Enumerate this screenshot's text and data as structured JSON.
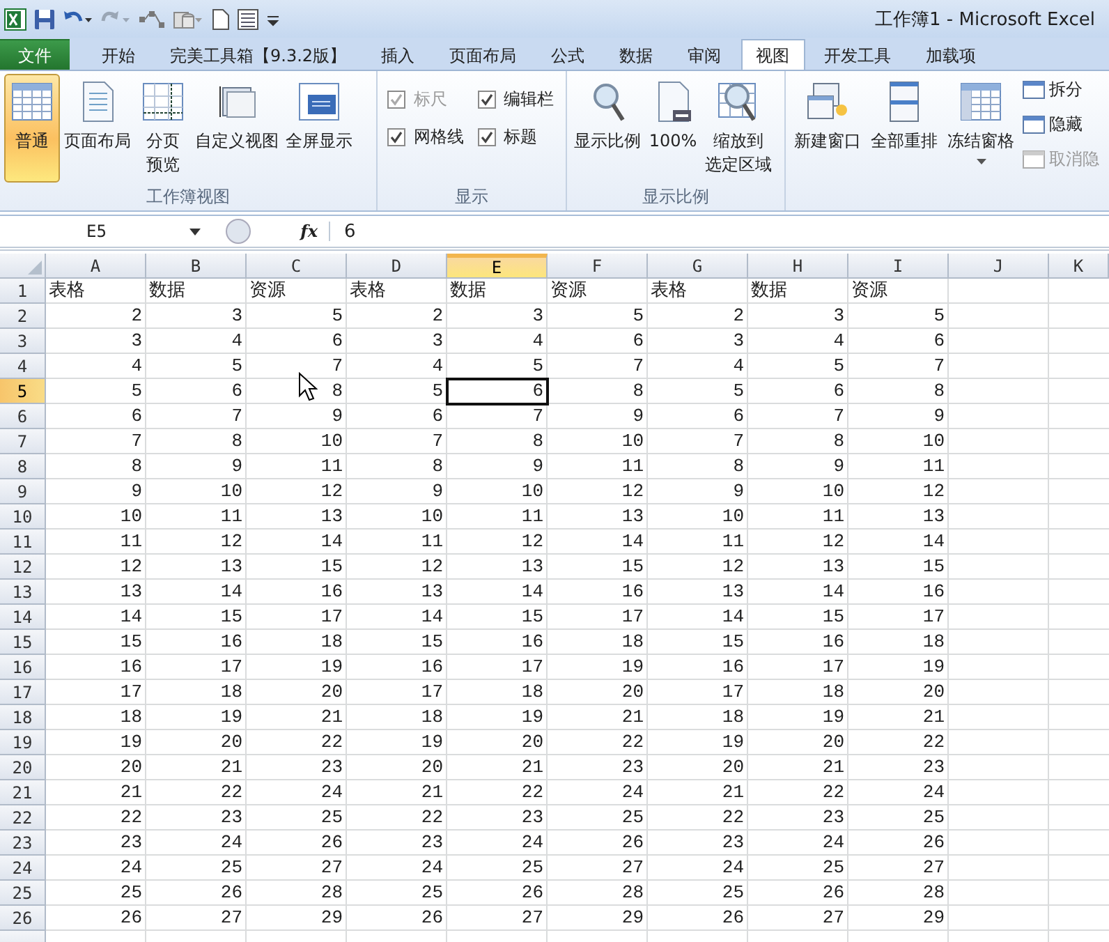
{
  "window": {
    "title": "工作簿1 - Microsoft Excel"
  },
  "tabs": [
    {
      "label": "文件",
      "kind": "file",
      "selected": false
    },
    {
      "label": "开始",
      "kind": "tab",
      "selected": false
    },
    {
      "label": "完美工具箱【9.3.2版】",
      "kind": "tab",
      "selected": false
    },
    {
      "label": "插入",
      "kind": "tab",
      "selected": false
    },
    {
      "label": "页面布局",
      "kind": "tab",
      "selected": false
    },
    {
      "label": "公式",
      "kind": "tab",
      "selected": false
    },
    {
      "label": "数据",
      "kind": "tab",
      "selected": false
    },
    {
      "label": "审阅",
      "kind": "tab",
      "selected": false
    },
    {
      "label": "视图",
      "kind": "tab",
      "selected": true
    },
    {
      "label": "开发工具",
      "kind": "tab",
      "selected": false
    },
    {
      "label": "加载项",
      "kind": "tab",
      "selected": false
    }
  ],
  "ribbon": {
    "groups": [
      {
        "label": "工作簿视图",
        "items": [
          {
            "kind": "big",
            "lines": [
              "普通"
            ],
            "selected": true
          },
          {
            "kind": "big",
            "lines": [
              "页面布局"
            ],
            "selected": false
          },
          {
            "kind": "big",
            "lines": [
              "分页",
              "预览"
            ],
            "selected": false
          },
          {
            "kind": "big",
            "lines": [
              "自定义视图"
            ],
            "selected": false
          },
          {
            "kind": "big",
            "lines": [
              "全屏显示"
            ],
            "selected": false
          }
        ]
      },
      {
        "label": "显示",
        "items": [
          {
            "kind": "check",
            "label": "标尺",
            "checked": true,
            "disabled": true
          },
          {
            "kind": "check",
            "label": "编辑栏",
            "checked": true,
            "disabled": false
          },
          {
            "kind": "check",
            "label": "网格线",
            "checked": true,
            "disabled": false
          },
          {
            "kind": "check",
            "label": "标题",
            "checked": true,
            "disabled": false
          }
        ]
      },
      {
        "label": "显示比例",
        "items": [
          {
            "kind": "big",
            "lines": [
              "显示比例"
            ],
            "selected": false
          },
          {
            "kind": "big",
            "lines": [
              "100%"
            ],
            "selected": false
          },
          {
            "kind": "big",
            "lines": [
              "缩放到",
              "选定区域"
            ],
            "selected": false
          }
        ]
      },
      {
        "items": [
          {
            "kind": "big",
            "lines": [
              "新建窗口"
            ],
            "selected": false
          },
          {
            "kind": "big",
            "lines": [
              "全部重排"
            ],
            "selected": false
          },
          {
            "kind": "big",
            "lines": [
              "冻结窗格"
            ],
            "selected": false,
            "dropdown": true
          },
          {
            "kind": "small",
            "label": "拆分",
            "disabled": false
          },
          {
            "kind": "small",
            "label": "隐藏",
            "disabled": false
          },
          {
            "kind": "small",
            "label": "取消隐",
            "disabled": true
          }
        ]
      }
    ]
  },
  "formula_bar": {
    "name_box": "E5",
    "fx_label": "fx",
    "value": "6"
  },
  "sheet": {
    "columns": [
      {
        "label": "A",
        "selected": false
      },
      {
        "label": "B",
        "selected": false
      },
      {
        "label": "C",
        "selected": false
      },
      {
        "label": "D",
        "selected": false
      },
      {
        "label": "E",
        "selected": true
      },
      {
        "label": "F",
        "selected": false
      },
      {
        "label": "G",
        "selected": false
      },
      {
        "label": "H",
        "selected": false
      },
      {
        "label": "I",
        "selected": false
      },
      {
        "label": "J",
        "selected": false
      },
      {
        "label": "K",
        "selected": false
      }
    ],
    "rows": [
      {
        "header": "1",
        "selected": false,
        "kind": "text",
        "cells": [
          "表格",
          "数据",
          "资源",
          "表格",
          "数据",
          "资源",
          "表格",
          "数据",
          "资源"
        ]
      },
      {
        "header": "2",
        "selected": false,
        "kind": "number",
        "cells": [
          "2",
          "3",
          "5",
          "2",
          "3",
          "5",
          "2",
          "3",
          "5"
        ]
      },
      {
        "header": "3",
        "selected": false,
        "kind": "number",
        "cells": [
          "3",
          "4",
          "6",
          "3",
          "4",
          "6",
          "3",
          "4",
          "6"
        ]
      },
      {
        "header": "4",
        "selected": false,
        "kind": "number",
        "cells": [
          "4",
          "5",
          "7",
          "4",
          "5",
          "7",
          "4",
          "5",
          "7"
        ]
      },
      {
        "header": "5",
        "selected": true,
        "kind": "number",
        "cells": [
          "5",
          "6",
          "8",
          "5",
          "6",
          "8",
          "5",
          "6",
          "8"
        ]
      },
      {
        "header": "6",
        "selected": false,
        "kind": "number",
        "cells": [
          "6",
          "7",
          "9",
          "6",
          "7",
          "9",
          "6",
          "7",
          "9"
        ]
      },
      {
        "header": "7",
        "selected": false,
        "kind": "number",
        "cells": [
          "7",
          "8",
          "10",
          "7",
          "8",
          "10",
          "7",
          "8",
          "10"
        ]
      },
      {
        "header": "8",
        "selected": false,
        "kind": "number",
        "cells": [
          "8",
          "9",
          "11",
          "8",
          "9",
          "11",
          "8",
          "9",
          "11"
        ]
      },
      {
        "header": "9",
        "selected": false,
        "kind": "number",
        "cells": [
          "9",
          "10",
          "12",
          "9",
          "10",
          "12",
          "9",
          "10",
          "12"
        ]
      },
      {
        "header": "10",
        "selected": false,
        "kind": "number",
        "cells": [
          "10",
          "11",
          "13",
          "10",
          "11",
          "13",
          "10",
          "11",
          "13"
        ]
      },
      {
        "header": "11",
        "selected": false,
        "kind": "number",
        "cells": [
          "11",
          "12",
          "14",
          "11",
          "12",
          "14",
          "11",
          "12",
          "14"
        ]
      },
      {
        "header": "12",
        "selected": false,
        "kind": "number",
        "cells": [
          "12",
          "13",
          "15",
          "12",
          "13",
          "15",
          "12",
          "13",
          "15"
        ]
      },
      {
        "header": "13",
        "selected": false,
        "kind": "number",
        "cells": [
          "13",
          "14",
          "16",
          "13",
          "14",
          "16",
          "13",
          "14",
          "16"
        ]
      },
      {
        "header": "14",
        "selected": false,
        "kind": "number",
        "cells": [
          "14",
          "15",
          "17",
          "14",
          "15",
          "17",
          "14",
          "15",
          "17"
        ]
      },
      {
        "header": "15",
        "selected": false,
        "kind": "number",
        "cells": [
          "15",
          "16",
          "18",
          "15",
          "16",
          "18",
          "15",
          "16",
          "18"
        ]
      },
      {
        "header": "16",
        "selected": false,
        "kind": "number",
        "cells": [
          "16",
          "17",
          "19",
          "16",
          "17",
          "19",
          "16",
          "17",
          "19"
        ]
      },
      {
        "header": "17",
        "selected": false,
        "kind": "number",
        "cells": [
          "17",
          "18",
          "20",
          "17",
          "18",
          "20",
          "17",
          "18",
          "20"
        ]
      },
      {
        "header": "18",
        "selected": false,
        "kind": "number",
        "cells": [
          "18",
          "19",
          "21",
          "18",
          "19",
          "21",
          "18",
          "19",
          "21"
        ]
      },
      {
        "header": "19",
        "selected": false,
        "kind": "number",
        "cells": [
          "19",
          "20",
          "22",
          "19",
          "20",
          "22",
          "19",
          "20",
          "22"
        ]
      },
      {
        "header": "20",
        "selected": false,
        "kind": "number",
        "cells": [
          "20",
          "21",
          "23",
          "20",
          "21",
          "23",
          "20",
          "21",
          "23"
        ]
      },
      {
        "header": "21",
        "selected": false,
        "kind": "number",
        "cells": [
          "21",
          "22",
          "24",
          "21",
          "22",
          "24",
          "21",
          "22",
          "24"
        ]
      },
      {
        "header": "22",
        "selected": false,
        "kind": "number",
        "cells": [
          "22",
          "23",
          "25",
          "22",
          "23",
          "25",
          "22",
          "23",
          "25"
        ]
      },
      {
        "header": "23",
        "selected": false,
        "kind": "number",
        "cells": [
          "23",
          "24",
          "26",
          "23",
          "24",
          "26",
          "23",
          "24",
          "26"
        ]
      },
      {
        "header": "24",
        "selected": false,
        "kind": "number",
        "cells": [
          "24",
          "25",
          "27",
          "24",
          "25",
          "27",
          "24",
          "25",
          "27"
        ]
      },
      {
        "header": "25",
        "selected": false,
        "kind": "number",
        "cells": [
          "25",
          "26",
          "28",
          "25",
          "26",
          "28",
          "25",
          "26",
          "28"
        ]
      },
      {
        "header": "26",
        "selected": false,
        "kind": "number",
        "cells": [
          "26",
          "27",
          "29",
          "26",
          "27",
          "29",
          "26",
          "27",
          "29"
        ]
      }
    ]
  }
}
